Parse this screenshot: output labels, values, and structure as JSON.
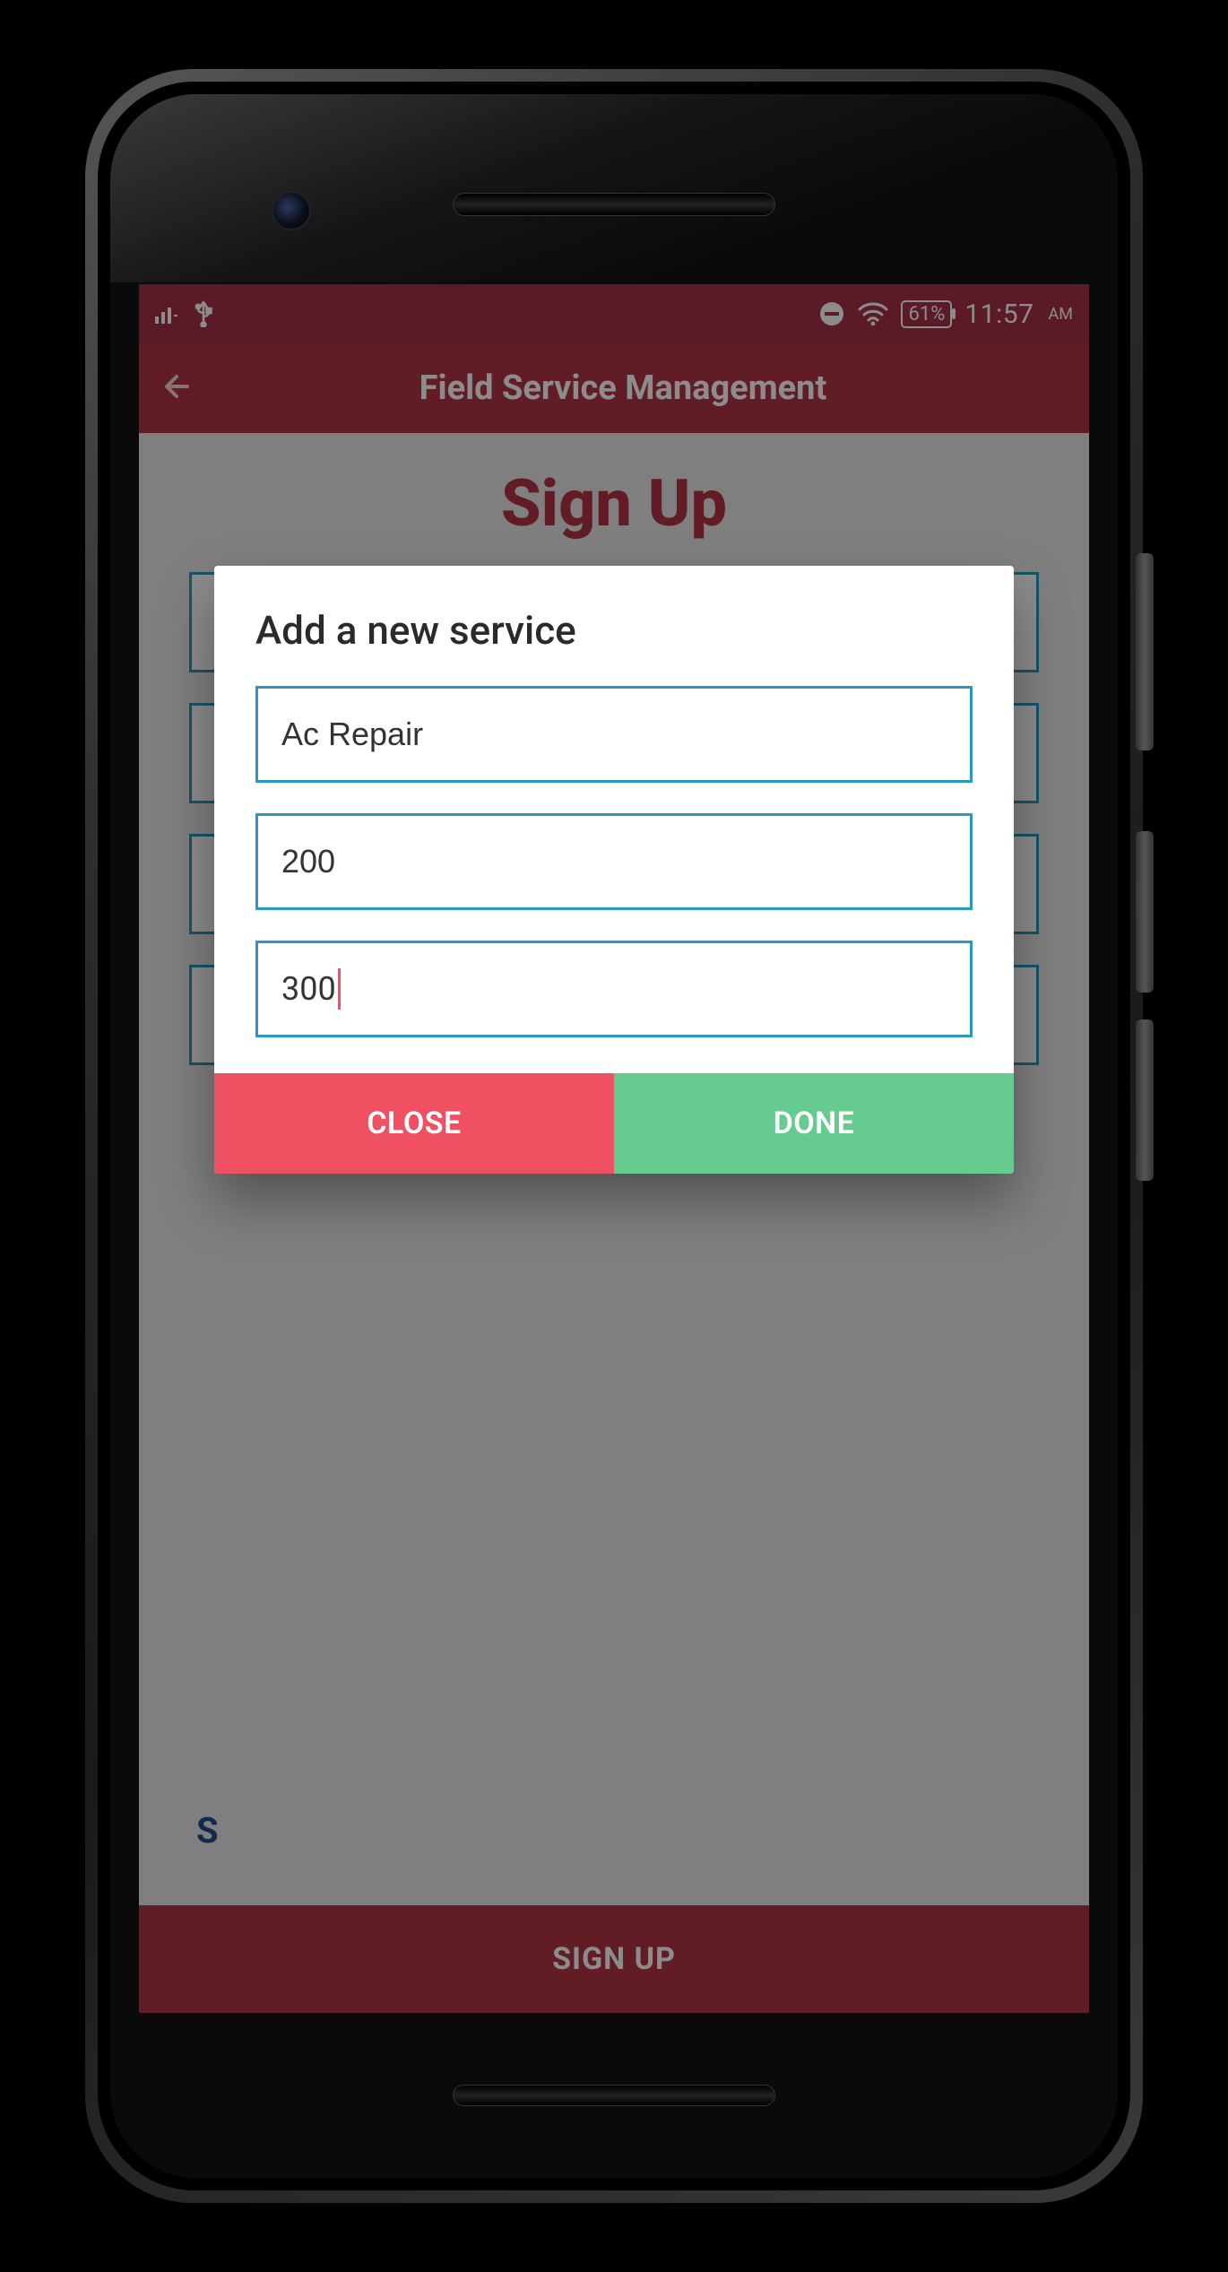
{
  "statusbar": {
    "battery_percent": "61%",
    "time": "11:57",
    "ampm": "AM"
  },
  "appbar": {
    "title": "Field Service Management"
  },
  "page": {
    "heading": "Sign Up",
    "signup_button": "SIGN UP"
  },
  "dialog": {
    "title": "Add a new service",
    "fields": {
      "service_name": "Ac Repair",
      "value_a": "200",
      "value_b": "300"
    },
    "actions": {
      "close": "CLOSE",
      "done": "DONE"
    }
  },
  "icons": {
    "signal": "signal-icon",
    "usb": "usb-icon",
    "dnd": "dnd-icon",
    "wifi": "wifi-icon",
    "battery": "battery-icon",
    "back": "back-arrow-icon"
  }
}
